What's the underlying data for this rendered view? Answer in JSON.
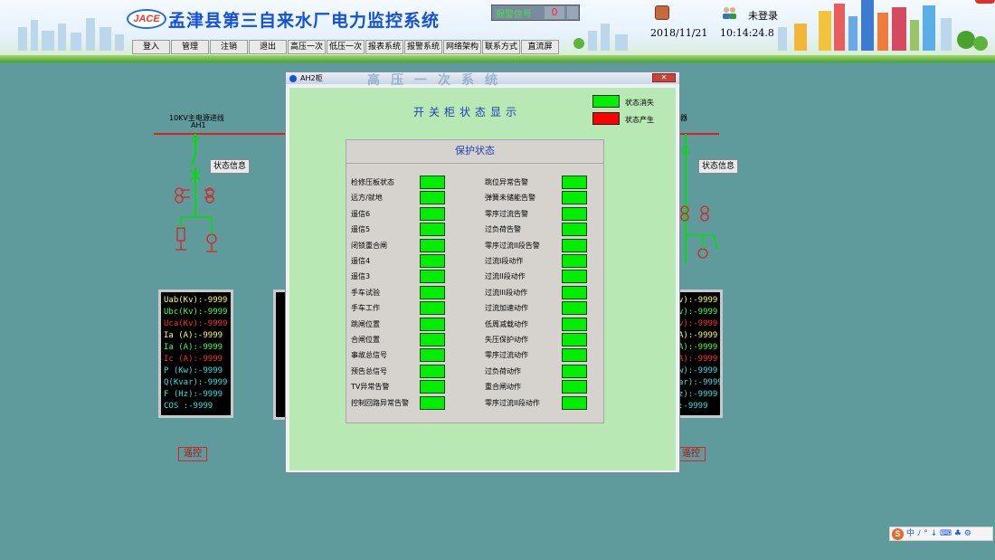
{
  "header": {
    "logo_text": "JACE",
    "title": "孟津县第三自来水厂电力监控系统",
    "alarm_label": "报警信号",
    "alarm_count": "0",
    "date": "2018/11/21",
    "time": "10:14:24.8",
    "login_status": "未登录",
    "menu": [
      "登入",
      "管理",
      "注销",
      "退出",
      "高压一次",
      "低压一次",
      "报表系统",
      "报警系统",
      "网络架构",
      "联系方式",
      "直流屏"
    ]
  },
  "diagram": {
    "line_label": "10KV主电源进线",
    "cabinet_label": "AH1",
    "right_partial_label": "器",
    "status_button": "状态信息",
    "remote_button": "遥控",
    "measurements": [
      {
        "label": "Uab(Kv)",
        "value": ":-9999",
        "color": "#ffff44"
      },
      {
        "label": "Ubc(Kv)",
        "value": ":-9999",
        "color": "#44ff44"
      },
      {
        "label": "Uca(Kv)",
        "value": ":-9999",
        "color": "#ff3030"
      },
      {
        "label": "Ia  (A)",
        "value": ":-9999",
        "color": "#ffff44"
      },
      {
        "label": "Ia  (A)",
        "value": ":-9999",
        "color": "#44ff44"
      },
      {
        "label": "Ic  (A)",
        "value": ":-9999",
        "color": "#ff3030"
      },
      {
        "label": "P  (Kw)",
        "value": ":-9999",
        "color": "#33e0e0"
      },
      {
        "label": "Q(Kvar)",
        "value": ":-9999",
        "color": "#33e0e0"
      },
      {
        "label": "F  (Hz)",
        "value": ":-9999",
        "color": "#33e0e0"
      },
      {
        "label": "COS    ",
        "value": ":-9999",
        "color": "#33e0e0"
      }
    ],
    "right_meas_labels": [
      "v)",
      "v)",
      "v)",
      "A)",
      "A)",
      "A)",
      "w)",
      "ar)",
      "z)",
      ""
    ]
  },
  "dialog": {
    "title": "AH2柜",
    "ghost_title": "高压一次系统",
    "heading": "开关柜状态显示",
    "legend": [
      {
        "label": "状态消失",
        "color": "#00ee00"
      },
      {
        "label": "状态产生",
        "color": "#ff0000"
      }
    ],
    "panel_title": "保护状态",
    "left_items": [
      "检修压板状态",
      "远方/就地",
      "遥信6",
      "遥信5",
      "闭锁重合闸",
      "遥信4",
      "遥信3",
      "手车试验",
      "手车工作",
      "跳闸位置",
      "合闸位置",
      "事故总信号",
      "预告总信号",
      "TV异常告警",
      "控制回路异常告警"
    ],
    "right_items": [
      "跳位异常告警",
      "弹簧未储能告警",
      "零序过流告警",
      "过负荷告警",
      "零序过流II段告警",
      "过流I段动作",
      "过流II段动作",
      "过流III段动作",
      "过流加速动作",
      "低周减载动作",
      "失压保护动作",
      "零序过流动作",
      "过负荷动作",
      "重合闸动作",
      "零序过流II段动作"
    ],
    "state_color": "#00ee00"
  },
  "tray": {
    "text": "中 ﾉ ° ↓ ⌨ ♣ ⚙"
  }
}
